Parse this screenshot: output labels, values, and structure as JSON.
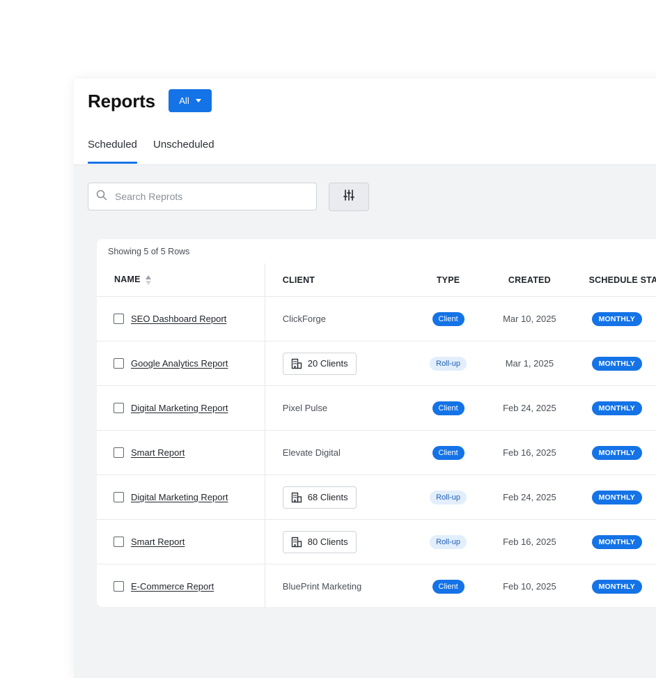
{
  "page": {
    "title": "Reports",
    "filter_label": "All"
  },
  "tabs": [
    {
      "label": "Scheduled",
      "active": true
    },
    {
      "label": "Unscheduled",
      "active": false
    }
  ],
  "search": {
    "placeholder": "Search Reprots",
    "icon": "search-icon"
  },
  "filter_button": {
    "icon": "sliders-icon"
  },
  "table": {
    "showing": "Showing 5 of 5 Rows",
    "headers": {
      "name": "NAME",
      "client": "CLIENT",
      "type": "TYPE",
      "created": "CREATED",
      "schedule": "SCHEDULE STATUS"
    },
    "rows": [
      {
        "name": "SEO Dashboard Report",
        "client": "ClickForge",
        "client_is_count": false,
        "type": "Client",
        "created": "Mar 10, 2025",
        "schedule": "MONTHLY"
      },
      {
        "name": "Google Analytics Report",
        "client": "20 Clients",
        "client_is_count": true,
        "type": "Roll-up",
        "created": "Mar 1, 2025",
        "schedule": "MONTHLY"
      },
      {
        "name": "Digital Marketing Report",
        "client": "Pixel Pulse",
        "client_is_count": false,
        "type": "Client",
        "created": "Feb 24, 2025",
        "schedule": "MONTHLY"
      },
      {
        "name": "Smart Report",
        "client": "Elevate Digital",
        "client_is_count": false,
        "type": "Client",
        "created": "Feb 16, 2025",
        "schedule": "MONTHLY"
      },
      {
        "name": "Digital Marketing Report",
        "client": "68 Clients",
        "client_is_count": true,
        "type": "Roll-up",
        "created": "Feb 24, 2025",
        "schedule": "MONTHLY"
      },
      {
        "name": "Smart Report",
        "client": "80 Clients",
        "client_is_count": true,
        "type": "Roll-up",
        "created": "Feb 16, 2025",
        "schedule": "MONTHLY"
      },
      {
        "name": "E-Commerce Report",
        "client": "BluePrint Marketing",
        "client_is_count": false,
        "type": "Client",
        "created": "Feb 10, 2025",
        "schedule": "MONTHLY"
      }
    ]
  },
  "colors": {
    "accent": "#1473e6",
    "rollup_bg": "#e2eefc",
    "rollup_text": "#1e5fb4"
  }
}
